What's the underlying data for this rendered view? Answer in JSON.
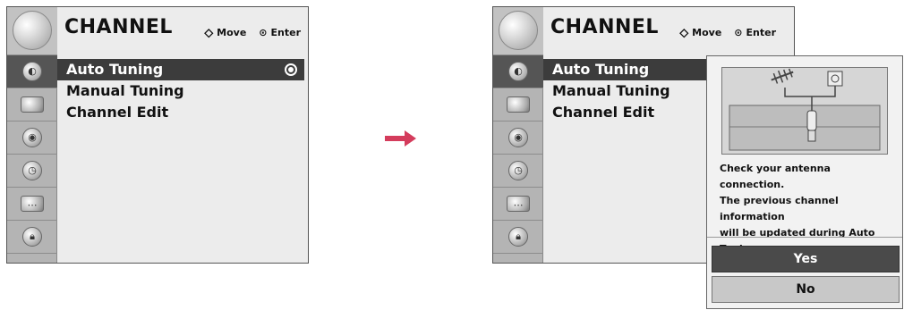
{
  "menu": {
    "title": "CHANNEL",
    "hint_move": "Move",
    "hint_enter": "Enter",
    "items": [
      {
        "label": "Auto Tuning"
      },
      {
        "label": "Manual Tuning"
      },
      {
        "label": "Channel Edit"
      }
    ],
    "sidebar_icons": [
      "channel-icon",
      "picture-icon",
      "audio-icon",
      "time-icon",
      "option-icon",
      "lock-icon"
    ]
  },
  "popup": {
    "message_lines": [
      "Check your antenna connection.",
      "The previous channel information",
      "will be updated during Auto",
      "Tuning."
    ],
    "yes_label": "Yes",
    "no_label": "No"
  },
  "colors": {
    "arrow": "#d43c5c",
    "selected_item": "#3c3c3c",
    "yes_button": "#4a4a4a",
    "no_button": "#c8c8c8"
  }
}
